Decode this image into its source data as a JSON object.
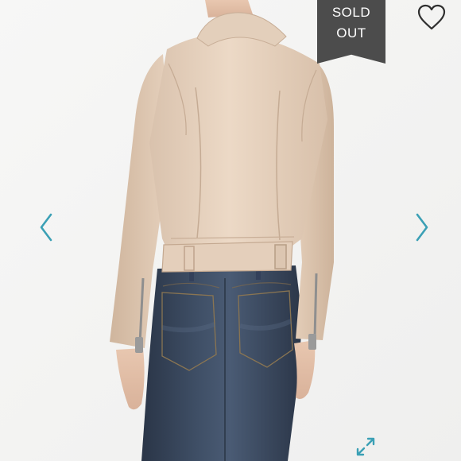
{
  "listing": {
    "status_badge": {
      "line1": "SOLD",
      "line2": "OUT",
      "background": "#4c4c4c",
      "color": "#ffffff"
    },
    "icons": {
      "like": "heart-icon",
      "previous": "chevron-left-icon",
      "next": "chevron-right-icon",
      "fullscreen": "expand-icon"
    },
    "accent_color": "#3ba0b5"
  }
}
